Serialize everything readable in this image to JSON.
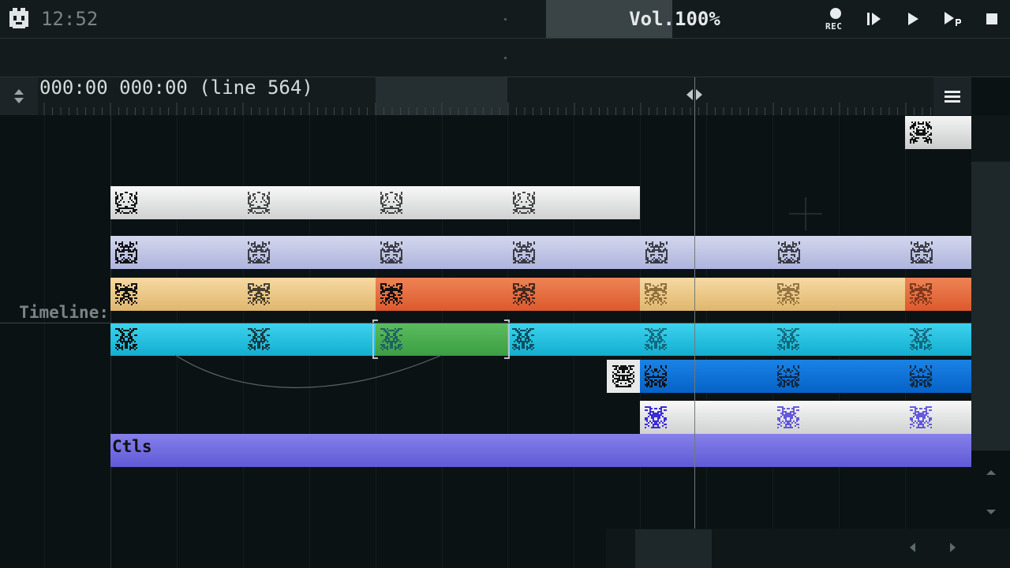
{
  "status": {
    "time": "12:52",
    "volume": "Vol.100%",
    "rec_label": "REC"
  },
  "timeline": {
    "position": "000:00 000:00 (line 564)",
    "label": "Timeline:"
  },
  "tracks": {
    "controllers_label": "Ctls"
  },
  "colors": {
    "white_pattern": "#e7e9e8",
    "lavender_pattern": "#c3c8e6",
    "tan_pattern": "#edc98a",
    "orange_pattern": "#e5683a",
    "cyan_pattern": "#1fc4e2",
    "green_pattern": "#4caf50",
    "blue_pattern": "#0a6fd8",
    "ctls_pattern": "#6f6ae0"
  },
  "icons": {
    "app": "ghost-icon",
    "record": "record-icon",
    "play_from_start": "play-from-start-icon",
    "play": "play-icon",
    "play_pattern": "play-pattern-icon",
    "stop": "stop-icon",
    "menu": "hamburger-menu-icon"
  }
}
